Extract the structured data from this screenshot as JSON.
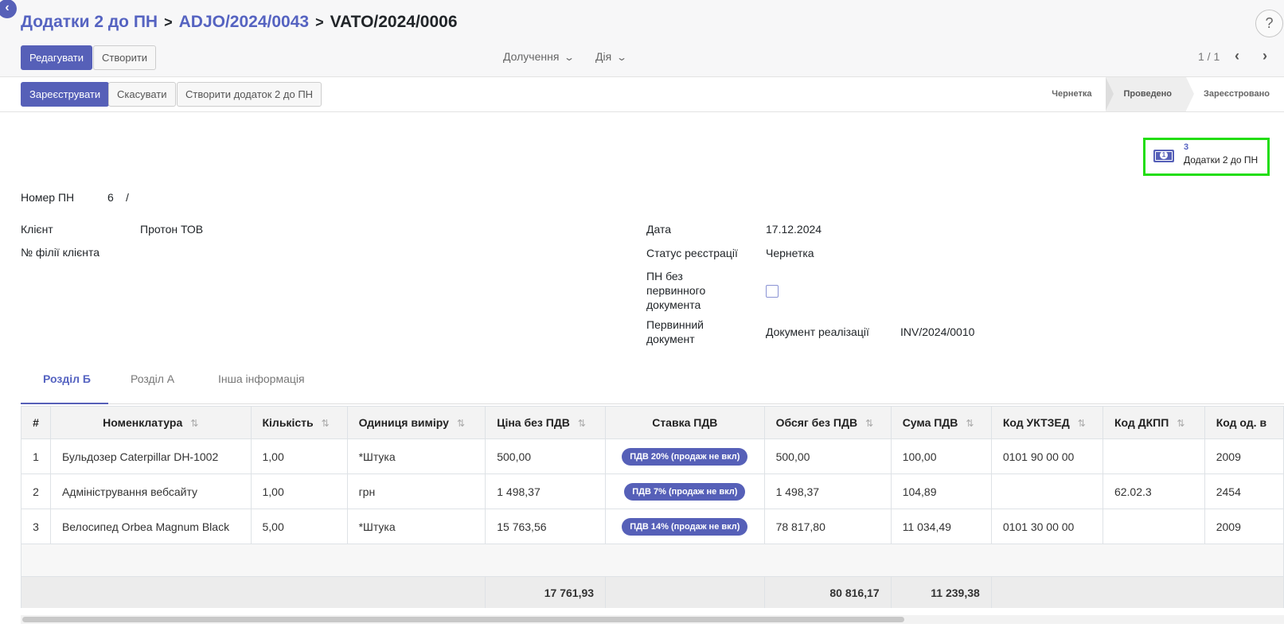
{
  "breadcrumb": {
    "item1": "Додатки 2 до ПН",
    "item2": "ADJO/2024/0043",
    "current": "VATO/2024/0006"
  },
  "help_label": "?",
  "toolbar": {
    "edit_label": "Редагувати",
    "create_label": "Створити",
    "receive_label": "Долучення",
    "action_label": "Дія",
    "pager_value": "1 / 1"
  },
  "statusbar": {
    "register_label": "Зареєструвати",
    "cancel_label": "Скасувати",
    "create_addendum_label": "Створити додаток 2 до ПН",
    "stages": [
      "Чернетка",
      "Проведено",
      "Зареєстровано"
    ],
    "active_stage": "Проведено"
  },
  "smart_button": {
    "count": "3",
    "label": "Додатки 2 до ПН"
  },
  "form": {
    "number_label": "Номер ПН",
    "number_value": "6",
    "number_sep": "/",
    "client_label": "Клієнт",
    "client_value": "Протон ТОВ",
    "branch_label": "№ філії клієнта",
    "date_label": "Дата",
    "date_value": "17.12.2024",
    "status_label": "Статус реєстрації",
    "status_value": "Чернетка",
    "no_primary_label_l1": "ПН без",
    "no_primary_label_l2": "первинного",
    "no_primary_label_l3": "документа",
    "primary_doc_label_l1": "Первинний",
    "primary_doc_label_l2": "документ",
    "primary_doc_type": "Документ реалізації",
    "primary_doc_value": "INV/2024/0010"
  },
  "tabs": [
    "Розділ Б",
    "Розділ А",
    "Інша інформація"
  ],
  "table": {
    "headers": [
      "#",
      "Номенклатура",
      "Кількість",
      "Одиниця виміру",
      "Ціна без ПДВ",
      "Ставка ПДВ",
      "Обсяг без ПДВ",
      "Сума ПДВ",
      "Код УКТЗЕД",
      "Код ДКПП",
      "Код од. в"
    ],
    "rows": [
      [
        "1",
        "Бульдозер Caterpillar DH-1002",
        "1,00",
        "*Штука",
        "500,00",
        "ПДВ 20% (продаж не вкл)",
        "500,00",
        "100,00",
        "0101 90 00 00",
        "",
        "2009"
      ],
      [
        "2",
        "Адміністрування вебсайту",
        "1,00",
        "грн",
        "1 498,37",
        "ПДВ 7% (продаж не вкл)",
        "1 498,37",
        "104,89",
        "",
        "62.02.3",
        "2454"
      ],
      [
        "3",
        "Велосипед Orbea Magnum Black",
        "5,00",
        "*Штука",
        "15 763,56",
        "ПДВ 14% (продаж не вкл)",
        "78 817,80",
        "11 034,49",
        "0101 30 00 00",
        "",
        "2009"
      ]
    ],
    "totals": {
      "price": "17 761,93",
      "amount": "80 816,17",
      "vat": "11 239,38"
    }
  },
  "colors": {
    "accent": "#5660b8",
    "link": "#5563c1",
    "highlight": "#22dd11"
  }
}
